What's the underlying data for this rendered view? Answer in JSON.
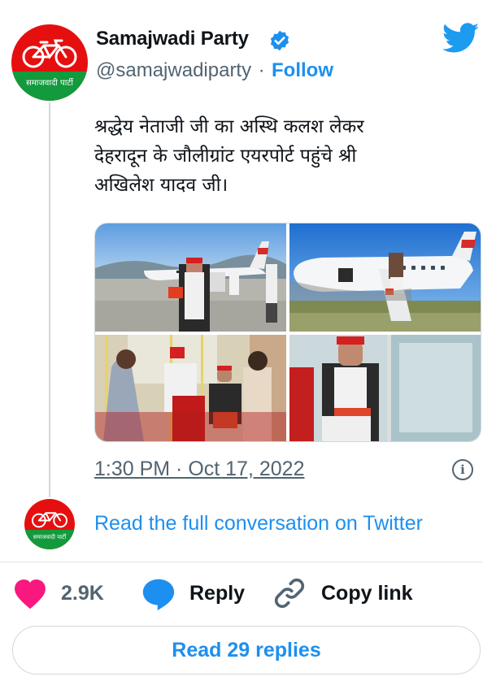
{
  "author": {
    "name": "Samajwadi Party",
    "handle": "@samajwadiparty",
    "separator": "·",
    "follow_label": "Follow",
    "avatar_text": "समाजवादी पार्टी"
  },
  "tweet": {
    "lines": [
      "श्रद्धेय नेताजी जी का अस्थि कलश लेकर",
      "देहरादून के जौलीग्रांट एयरपोर्ट पहुंचे श्री",
      "अखिलेश यादव जी।"
    ],
    "timestamp": "1:30 PM · Oct 17, 2022"
  },
  "conversation": {
    "read_full_label": "Read the full conversation on Twitter"
  },
  "actions": {
    "likes_count": "2.9K",
    "reply_label": "Reply",
    "copy_link_label": "Copy link"
  },
  "footer": {
    "read_replies_label": "Read 29 replies"
  },
  "colors": {
    "accent": "#1d8ff0",
    "like": "#f91880",
    "party_red": "#e60f0f",
    "party_green": "#129a3c"
  },
  "icons": [
    "twitter-bird-icon",
    "verified-badge-icon",
    "info-icon",
    "heart-icon",
    "reply-bubble-icon",
    "link-icon"
  ]
}
